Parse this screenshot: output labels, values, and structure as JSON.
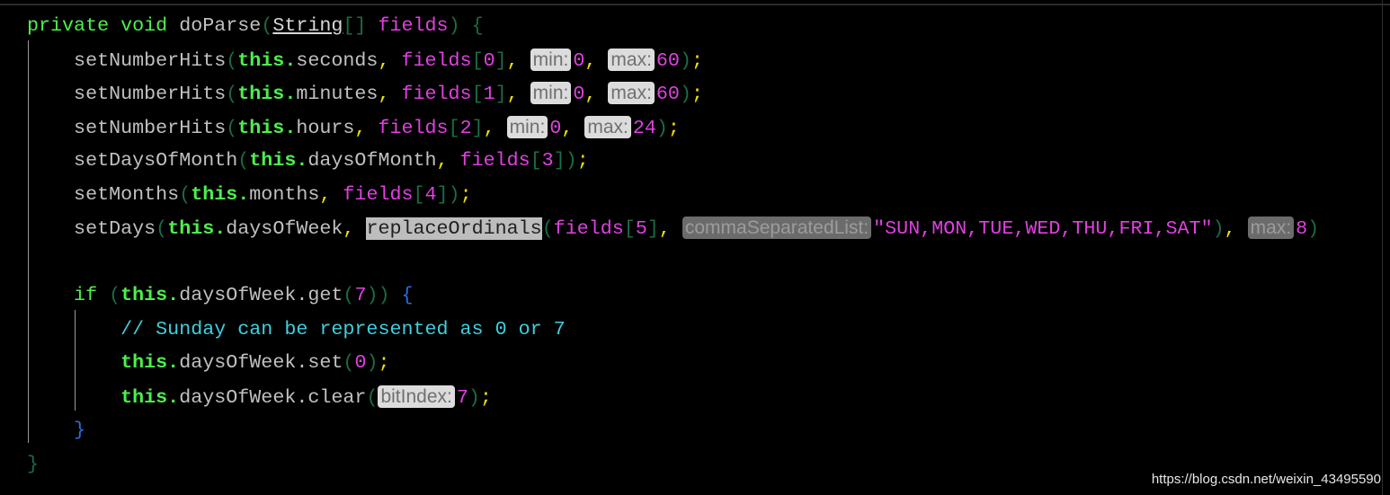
{
  "editor": {
    "highlighted_line": 6,
    "lines": [
      [
        [
          "kw",
          "private void "
        ],
        [
          "plain",
          "doParse"
        ],
        [
          "paren",
          "("
        ],
        [
          "type",
          "String"
        ],
        [
          "paren",
          "[] "
        ],
        [
          "var",
          "fields"
        ],
        [
          "paren",
          ")"
        ],
        [
          "plain",
          " "
        ],
        [
          "brace",
          "{"
        ]
      ],
      [
        [
          "plain",
          "    setNumberHits"
        ],
        [
          "paren",
          "("
        ],
        [
          "this",
          "this."
        ],
        [
          "plain",
          "seconds"
        ],
        [
          "punct",
          ", "
        ],
        [
          "var",
          "fields"
        ],
        [
          "paren",
          "["
        ],
        [
          "num",
          "0"
        ],
        [
          "paren",
          "]"
        ],
        [
          "punct",
          ", "
        ],
        [
          "hint",
          "min:"
        ],
        [
          "num",
          "0"
        ],
        [
          "punct",
          ", "
        ],
        [
          "hint",
          "max:"
        ],
        [
          "num",
          "60"
        ],
        [
          "paren",
          ")"
        ],
        [
          "punct",
          ";"
        ]
      ],
      [
        [
          "plain",
          "    setNumberHits"
        ],
        [
          "paren",
          "("
        ],
        [
          "this",
          "this."
        ],
        [
          "plain",
          "minutes"
        ],
        [
          "punct",
          ", "
        ],
        [
          "var",
          "fields"
        ],
        [
          "paren",
          "["
        ],
        [
          "num",
          "1"
        ],
        [
          "paren",
          "]"
        ],
        [
          "punct",
          ", "
        ],
        [
          "hint",
          "min:"
        ],
        [
          "num",
          "0"
        ],
        [
          "punct",
          ", "
        ],
        [
          "hint",
          "max:"
        ],
        [
          "num",
          "60"
        ],
        [
          "paren",
          ")"
        ],
        [
          "punct",
          ";"
        ]
      ],
      [
        [
          "plain",
          "    setNumberHits"
        ],
        [
          "paren",
          "("
        ],
        [
          "this",
          "this."
        ],
        [
          "plain",
          "hours"
        ],
        [
          "punct",
          ", "
        ],
        [
          "var",
          "fields"
        ],
        [
          "paren",
          "["
        ],
        [
          "num",
          "2"
        ],
        [
          "paren",
          "]"
        ],
        [
          "punct",
          ", "
        ],
        [
          "hint",
          "min:"
        ],
        [
          "num",
          "0"
        ],
        [
          "punct",
          ", "
        ],
        [
          "hint",
          "max:"
        ],
        [
          "num",
          "24"
        ],
        [
          "paren",
          ")"
        ],
        [
          "punct",
          ";"
        ]
      ],
      [
        [
          "plain",
          "    setDaysOfMonth"
        ],
        [
          "paren",
          "("
        ],
        [
          "this",
          "this."
        ],
        [
          "plain",
          "daysOfMonth"
        ],
        [
          "punct",
          ", "
        ],
        [
          "var",
          "fields"
        ],
        [
          "paren",
          "["
        ],
        [
          "num",
          "3"
        ],
        [
          "paren",
          "])"
        ],
        [
          "punct",
          ";"
        ]
      ],
      [
        [
          "plain",
          "    setMonths"
        ],
        [
          "paren",
          "("
        ],
        [
          "this",
          "this."
        ],
        [
          "plain",
          "months"
        ],
        [
          "punct",
          ", "
        ],
        [
          "var",
          "fields"
        ],
        [
          "paren",
          "["
        ],
        [
          "num",
          "4"
        ],
        [
          "paren",
          "])"
        ],
        [
          "punct",
          ";"
        ]
      ],
      [
        [
          "plain",
          "    setDays"
        ],
        [
          "paren",
          "("
        ],
        [
          "this",
          "this."
        ],
        [
          "plain",
          "daysOfWeek"
        ],
        [
          "punct",
          ", "
        ],
        [
          "sel",
          "replaceOrdinals"
        ],
        [
          "paren",
          "("
        ],
        [
          "var",
          "fields"
        ],
        [
          "paren",
          "["
        ],
        [
          "num",
          "5"
        ],
        [
          "paren",
          "]"
        ],
        [
          "punct",
          ", "
        ],
        [
          "hint",
          "commaSeparatedList:"
        ],
        [
          "str",
          "\"SUN,MON,TUE,WED,THU,FRI,SAT\""
        ],
        [
          "paren",
          ")"
        ],
        [
          "punct",
          ", "
        ],
        [
          "hint",
          "max:"
        ],
        [
          "num",
          "8"
        ],
        [
          "paren",
          ")"
        ]
      ],
      [],
      [
        [
          "kw",
          "    if "
        ],
        [
          "paren",
          "("
        ],
        [
          "this",
          "this."
        ],
        [
          "plain",
          "daysOfWeek.get"
        ],
        [
          "paren",
          "("
        ],
        [
          "num",
          "7"
        ],
        [
          "paren",
          "))"
        ],
        [
          "plain",
          " "
        ],
        [
          "bluebrace",
          "{"
        ]
      ],
      [
        [
          "comment",
          "        // Sunday can be represented as 0 or 7"
        ]
      ],
      [
        [
          "this",
          "        this."
        ],
        [
          "plain",
          "daysOfWeek.set"
        ],
        [
          "paren",
          "("
        ],
        [
          "num",
          "0"
        ],
        [
          "paren",
          ")"
        ],
        [
          "punct",
          ";"
        ]
      ],
      [
        [
          "this",
          "        this."
        ],
        [
          "plain",
          "daysOfWeek.clear"
        ],
        [
          "paren",
          "("
        ],
        [
          "hint",
          "bitIndex:"
        ],
        [
          "num",
          "7"
        ],
        [
          "paren",
          ")"
        ],
        [
          "punct",
          ";"
        ]
      ],
      [
        [
          "bluebrace",
          "    }"
        ]
      ],
      [
        [
          "brace",
          "}"
        ]
      ]
    ]
  },
  "watermark": "https://blog.csdn.net/weixin_43495590"
}
